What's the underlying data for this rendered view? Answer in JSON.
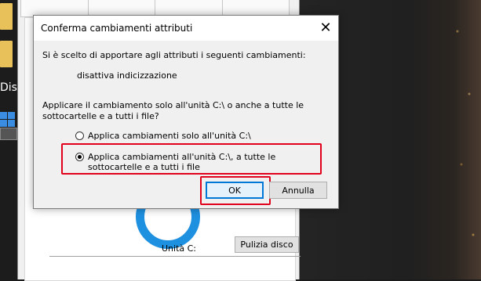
{
  "desktop": {
    "icon_label": "Dis"
  },
  "properties_window": {
    "drive_label": "Unità C:",
    "cleanup_button": "Pulizia disco"
  },
  "dialog": {
    "title": "Conferma cambiamenti attributi",
    "close_glyph": "✕",
    "intro": "Si è scelto di apportare agli attributi i seguenti cambiamenti:",
    "change": "disattiva indicizzazione",
    "question": "Applicare il cambiamento solo all'unità C:\\ o anche a tutte le sottocartelle e a tutti i file?",
    "options": [
      {
        "label": "Applica cambiamenti solo all'unità C:\\",
        "selected": false
      },
      {
        "label": "Applica cambiamenti all'unità C:\\, a tutte le sottocartelle e a tutti i file",
        "selected": true
      }
    ],
    "ok_button": "OK",
    "cancel_button": "Annulla"
  },
  "colors": {
    "highlight": "#e0001b",
    "accent": "#0078d7",
    "chart": "#1e90e0"
  }
}
